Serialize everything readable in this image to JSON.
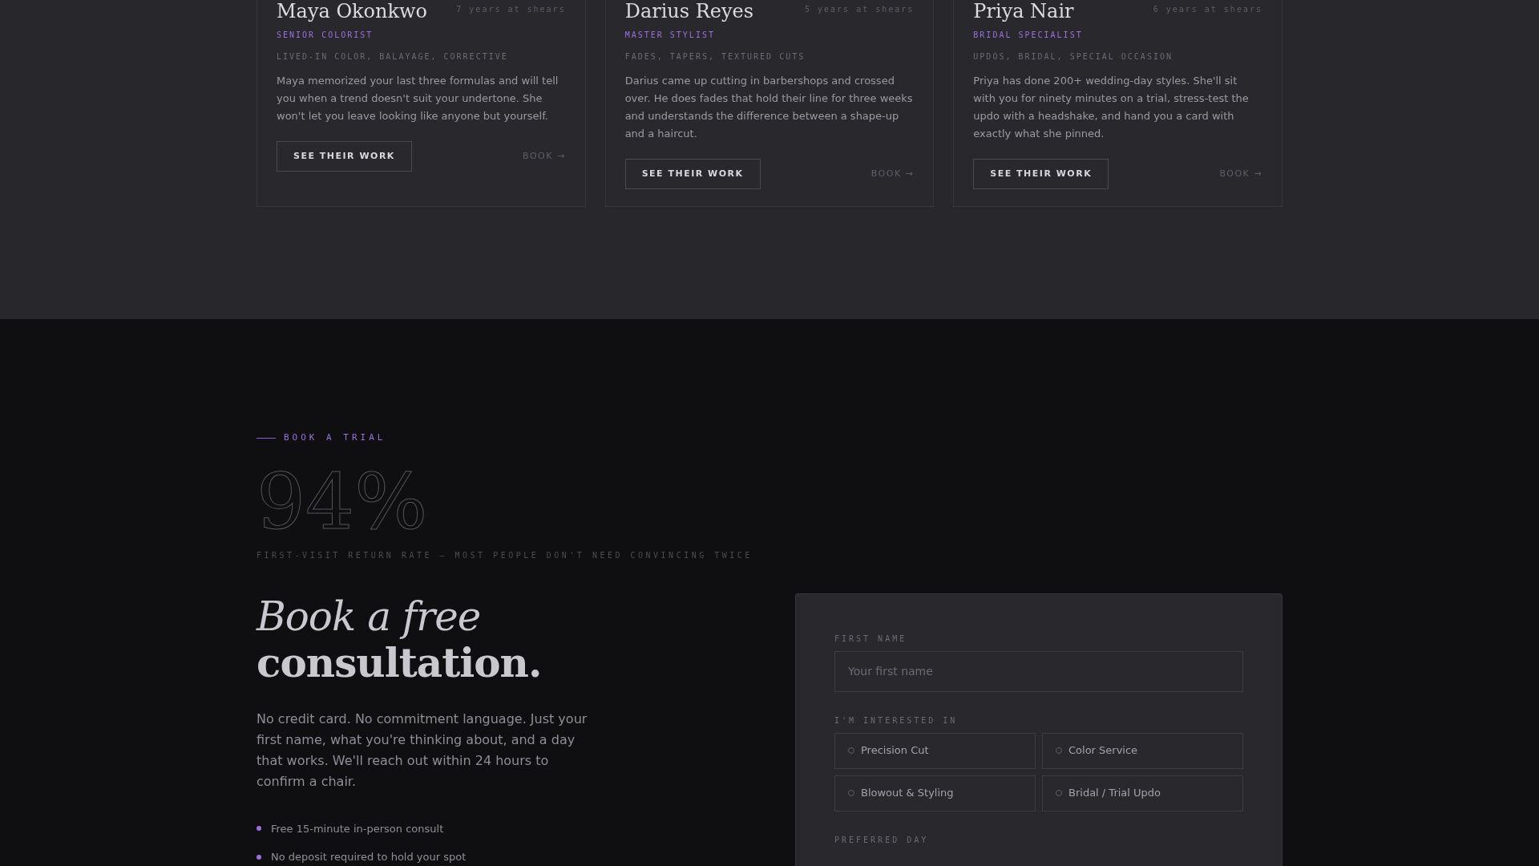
{
  "stylists": [
    {
      "name": "Maya Okonkwo",
      "tenure": "7 years at shears",
      "role": "SENIOR COLORIST",
      "specialties": "LIVED-IN COLOR, BALAYAGE, CORRECTIVE",
      "bio": "Maya memorized your last three formulas and will tell you when a trend doesn't suit your undertone. She won't let you leave looking like anyone but yourself.",
      "work_button": "SEE THEIR WORK",
      "book_link": "BOOK →"
    },
    {
      "name": "Darius Reyes",
      "tenure": "5 years at shears",
      "role": "MASTER STYLIST",
      "specialties": "FADES, TAPERS, TEXTURED CUTS",
      "bio": "Darius came up cutting in barbershops and crossed over. He does fades that hold their line for three weeks and understands the difference between a shape-up and a haircut.",
      "work_button": "SEE THEIR WORK",
      "book_link": "BOOK →"
    },
    {
      "name": "Priya Nair",
      "tenure": "6 years at shears",
      "role": "BRIDAL SPECIALIST",
      "specialties": "UPDOS, BRIDAL, SPECIAL OCCASION",
      "bio": "Priya has done 200+ wedding-day styles. She'll sit with you for ninety minutes on a trial, stress-test the updo with a headshake, and hand you a card with exactly what she pinned.",
      "work_button": "SEE THEIR WORK",
      "book_link": "BOOK →"
    }
  ],
  "booking": {
    "eyebrow": "BOOK A TRIAL",
    "stat": "94%",
    "stat_caption": "FIRST-VISIT RETURN RATE — MOST PEOPLE DON'T NEED CONVINCING TWICE",
    "heading_italic": "Book a free",
    "heading_bold": "consultation.",
    "intro": "No credit card. No commitment language. Just your first name, what you're thinking about, and a day that works. We'll reach out within 24 hours to confirm a chair.",
    "perks": [
      "Free 15-minute in-person consult",
      "No deposit required to hold your spot"
    ]
  },
  "form": {
    "first_name_label": "FIRST NAME",
    "first_name_placeholder": "Your first name",
    "interest_label": "I'M INTERESTED IN",
    "interests": [
      {
        "label": "Precision Cut",
        "selected": false
      },
      {
        "label": "Color Service",
        "selected": false
      },
      {
        "label": "Blowout & Styling",
        "selected": false
      },
      {
        "label": "Bridal / Trial Updo",
        "selected": false
      }
    ],
    "day_label": "PREFERRED DAY"
  }
}
